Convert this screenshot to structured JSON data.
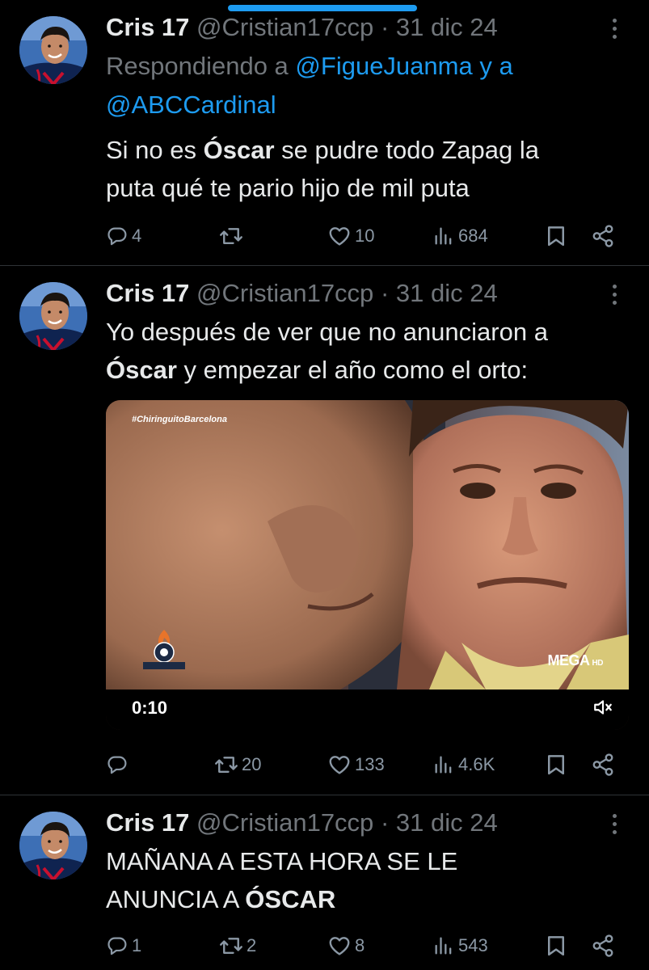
{
  "colors": {
    "background": "#000000",
    "text": "#e7e9ea",
    "muted": "#71767b",
    "link": "#1d9bf0",
    "divider": "#2f3336"
  },
  "tweets": [
    {
      "author": {
        "name": "Cris 17",
        "handle": "@Cristian17ccp",
        "date": "31 dic 24",
        "separator": "·"
      },
      "replying": {
        "prefix": "Respondiendo a",
        "user1": "@FigueJuanma",
        "conj": "y a",
        "user2": "@ABCCardinal"
      },
      "text": {
        "line1_pre": "Si no es ",
        "line1_bold": "Óscar",
        "line1_post": " se pudre todo Zapag la",
        "line2": "puta qué te pario hijo de mil puta"
      },
      "actions": {
        "replies": "4",
        "retweets": "",
        "likes": "10",
        "views": "684"
      },
      "icons": [
        "reply-icon",
        "retweet-icon",
        "like-icon",
        "views-icon",
        "bookmark-icon",
        "share-icon"
      ]
    },
    {
      "author": {
        "name": "Cris 17",
        "handle": "@Cristian17ccp",
        "date": "31 dic 24",
        "separator": "·"
      },
      "text": {
        "line1": "Yo después de ver que no anunciaron a",
        "line2_bold": "Óscar",
        "line2_post": " y empezar el año como el orto:"
      },
      "media": {
        "hashtag": "#ChiringuitoBarcelona",
        "duration": "0:10",
        "channel": "MEGA",
        "channel_suffix": "HD",
        "logo_text": "CHIRINGUITO",
        "logo_subtext": "DE JUGONES"
      },
      "actions": {
        "replies": "",
        "retweets": "20",
        "likes": "133",
        "views": "4.6K"
      }
    },
    {
      "author": {
        "name": "Cris 17",
        "handle": "@Cristian17ccp",
        "date": "31 dic 24",
        "separator": "·"
      },
      "text": {
        "line1": "MAÑANA A ESTA HORA SE LE",
        "line2_pre": "ANUNCIA A ",
        "line2_bold": "ÓSCAR"
      },
      "actions": {
        "replies": "1",
        "retweets": "2",
        "likes": "8",
        "views": "543"
      }
    }
  ]
}
